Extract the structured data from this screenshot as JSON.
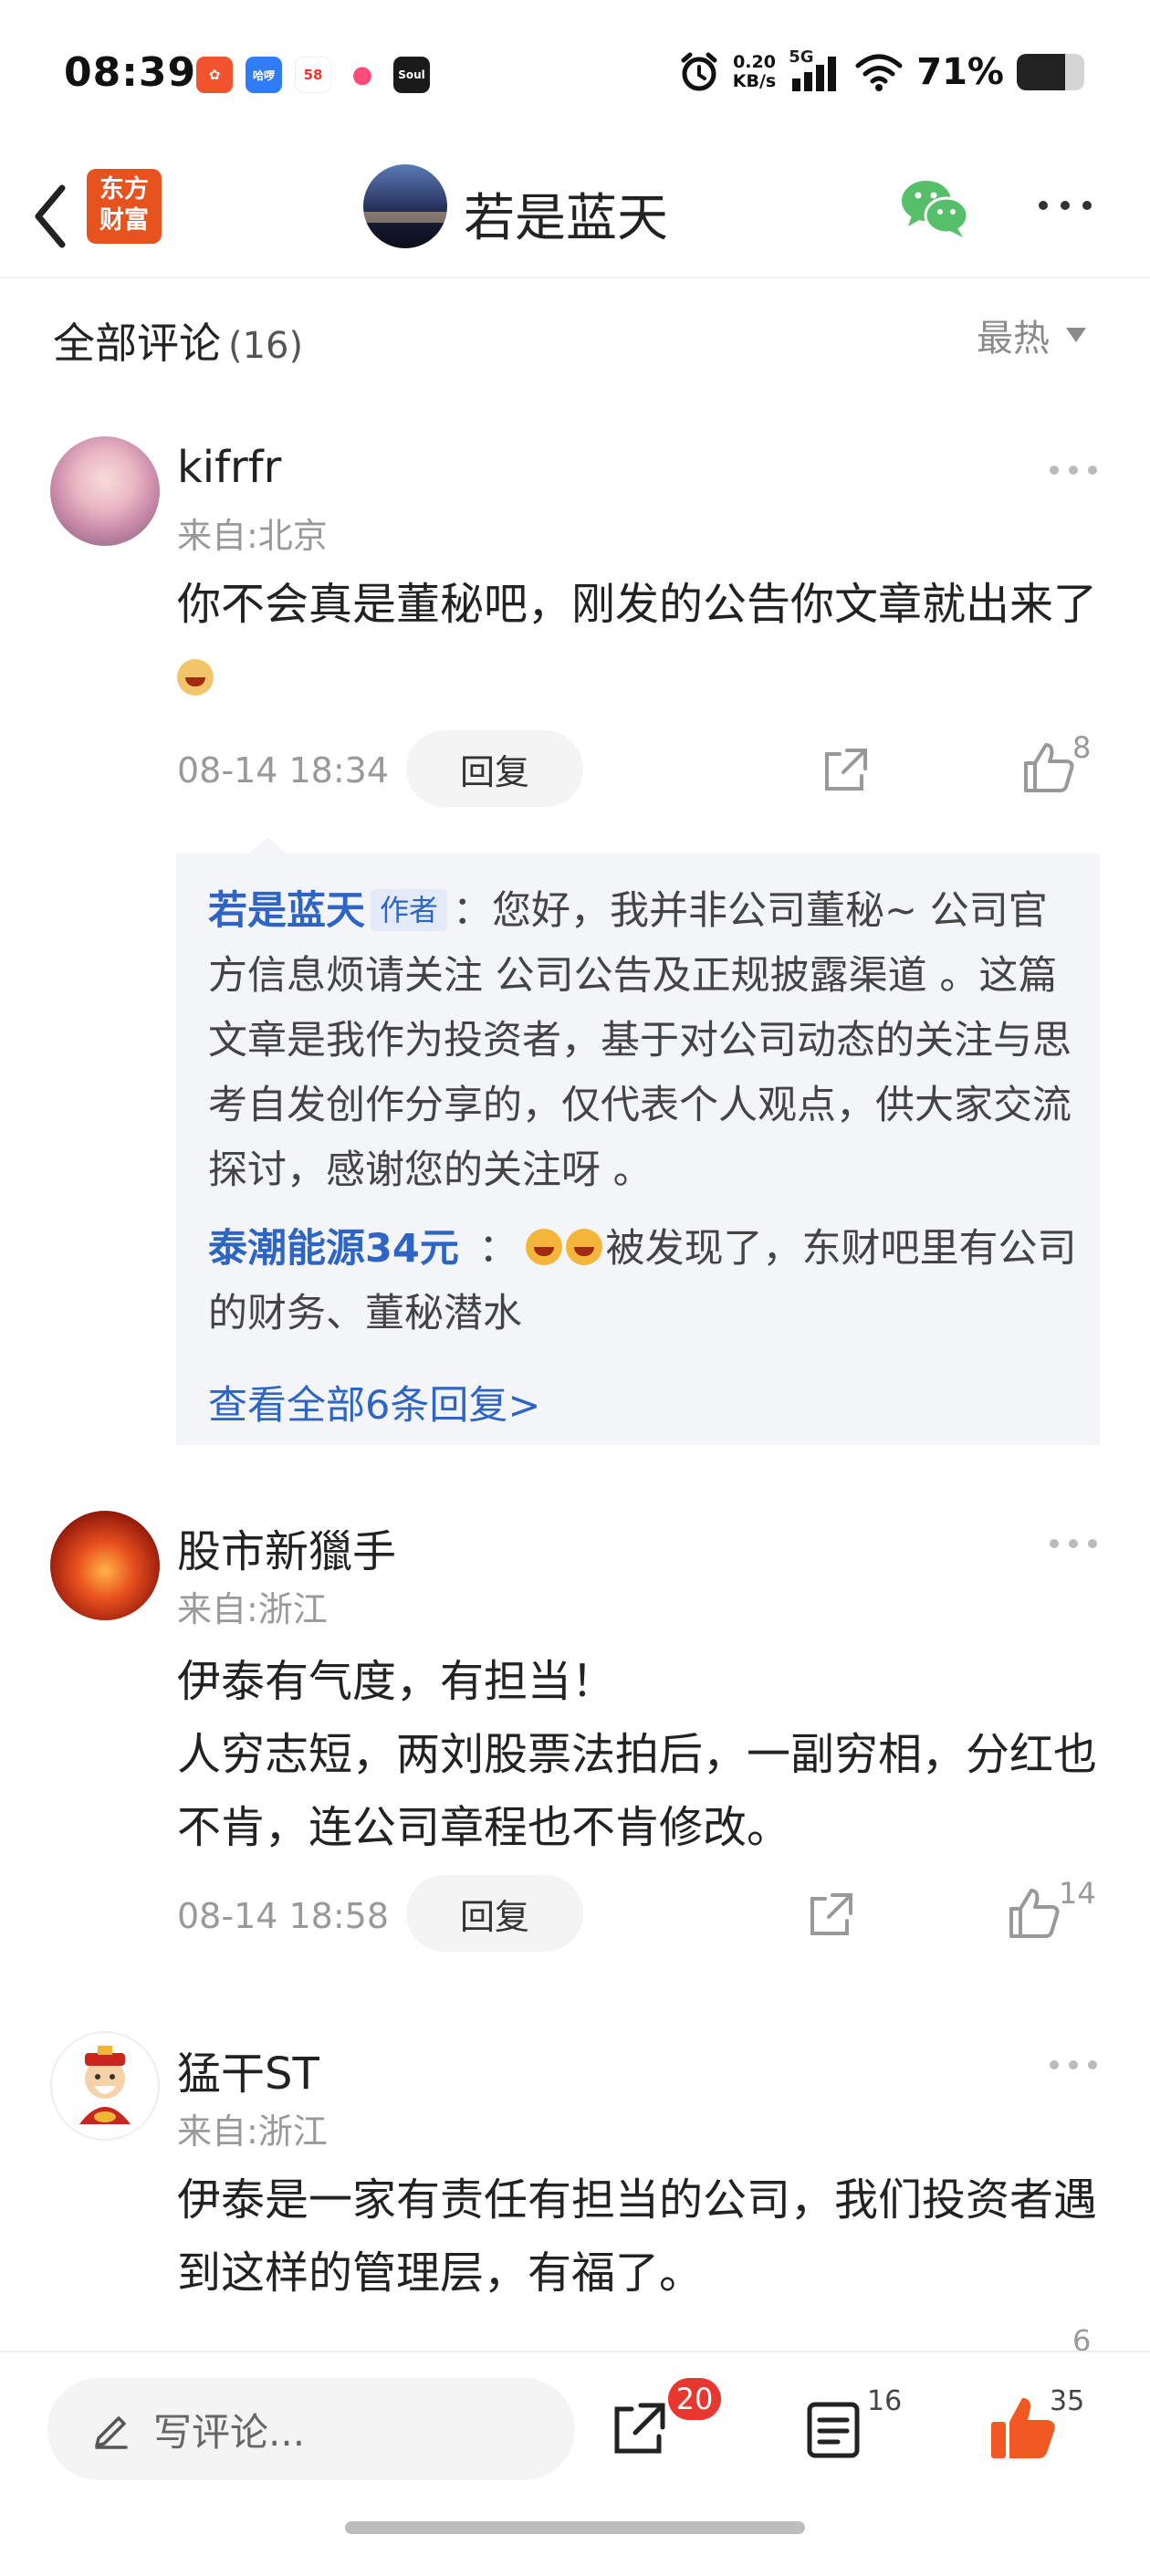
{
  "status_bar": {
    "time": "08:39",
    "apps": [
      {
        "name": "app-icon-1",
        "label": "",
        "color": "#f0532d"
      },
      {
        "name": "app-icon-2",
        "label": "哈啰",
        "color": "#2f7cf6"
      },
      {
        "name": "app-icon-3",
        "label": "58",
        "color": "#ffffff"
      },
      {
        "name": "app-icon-4",
        "label": "",
        "color": "#ff4b7a"
      },
      {
        "name": "app-icon-soul",
        "label": "Soul",
        "color": "#1a1a1a"
      }
    ],
    "net_speed_value": "0.20",
    "net_speed_unit": "KB/s",
    "network": "5G",
    "battery_percent_text": "71%",
    "battery_level": 0.71
  },
  "header": {
    "logo_text": "东方财富",
    "title": "若是蓝天"
  },
  "comments_header": {
    "label": "全部评论",
    "count": "(16)",
    "sort": "最热"
  },
  "comments": [
    {
      "name": "kifrfr",
      "location": "来自:北京",
      "text": "你不会真是董秘吧，刚发的公告你文章就出来了",
      "time": "08-14 18:34",
      "reply_label": "回复",
      "likes": "8",
      "replies": [
        {
          "name": "若是蓝天",
          "tag": "作者",
          "text": "：您好，我并非公司董秘~ 公司官方信息烦请关注 公司公告及正规披露渠道 。这篇文章是我作为投资者，基于对公司动态的关注与思考自发创作分享的，仅代表个人观点，供大家交流探讨，感谢您的关注呀 。"
        },
        {
          "name": "泰潮能源34元",
          "text": "被发现了，东财吧里有公司的财务、董秘潜水"
        }
      ],
      "view_all": "查看全部6条回复>"
    },
    {
      "name": "股市新獵手",
      "location": "来自:浙江",
      "text_line1": "伊泰有气度，有担当！",
      "text_line2": "人穷志短，两刘股票法拍后，一副穷相，分红也不肯，连公司章程也不肯修改。",
      "time": "08-14 18:58",
      "reply_label": "回复",
      "likes": "14"
    },
    {
      "name": "猛干ST",
      "location": "来自:浙江",
      "text": "伊泰是一家有责任有担当的公司，我们投资者遇到这样的管理层，有福了。",
      "likes": "6"
    }
  ],
  "bottom_bar": {
    "input_placeholder": "写评论...",
    "share_badge": "20",
    "comment_count": "16",
    "like_count": "35"
  },
  "colors": {
    "accent_blue": "#2e65c5",
    "like_orange": "#f05a22",
    "badge_red": "#e8372e",
    "brand_orange": "#e6531e"
  }
}
